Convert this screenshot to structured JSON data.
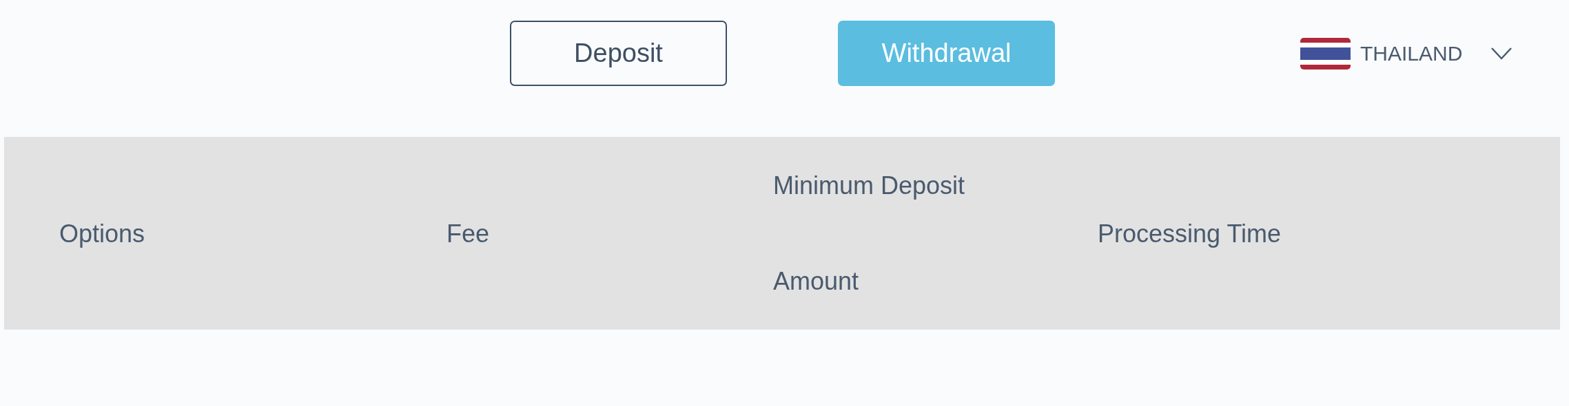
{
  "tabs": [
    {
      "label": "Deposit",
      "selected": false
    },
    {
      "label": "Withdrawal",
      "selected": true
    }
  ],
  "country": {
    "label": "THAILAND"
  },
  "table": {
    "columns": [
      "Options",
      "Fee",
      "Minimum Deposit Amount",
      "Processing Time"
    ]
  }
}
